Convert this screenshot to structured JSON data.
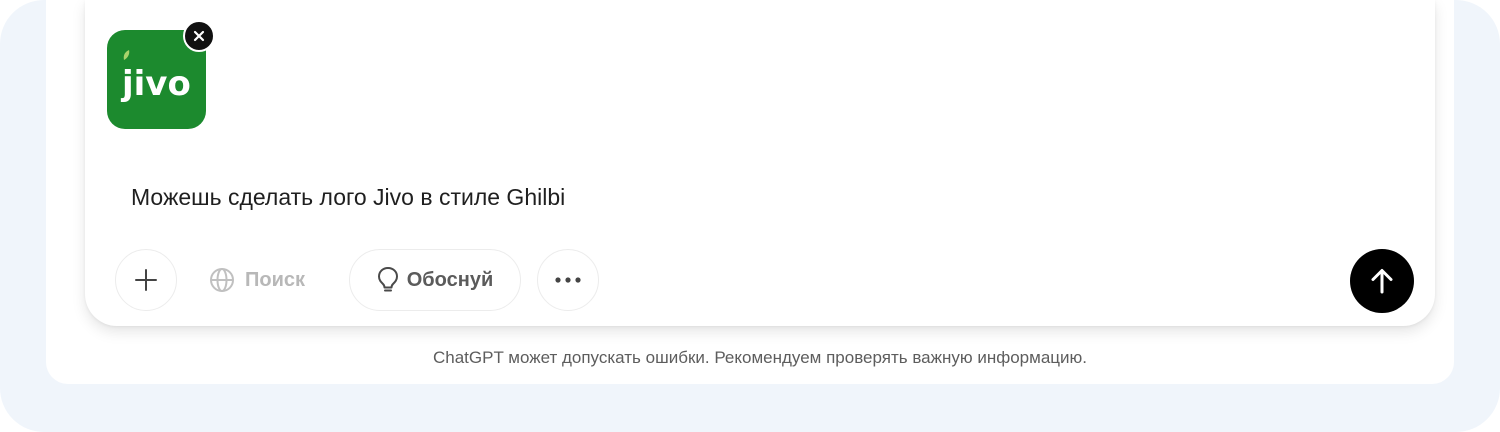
{
  "attachment": {
    "logo_text": "jivo",
    "logo_color": "#1c8a2e",
    "remove_icon": "close-icon"
  },
  "composer": {
    "prompt_text": "Можешь сделать лого Jivo в стиле Ghilbi"
  },
  "toolbar": {
    "add_icon": "plus-icon",
    "search_label": "Поиск",
    "search_icon": "globe-icon",
    "reason_label": "Обоснуй",
    "reason_icon": "lightbulb-icon",
    "more_icon": "ellipsis-icon",
    "send_icon": "arrow-up-icon"
  },
  "footer": {
    "disclaimer": "ChatGPT может допускать ошибки. Рекомендуем проверять важную информацию."
  }
}
